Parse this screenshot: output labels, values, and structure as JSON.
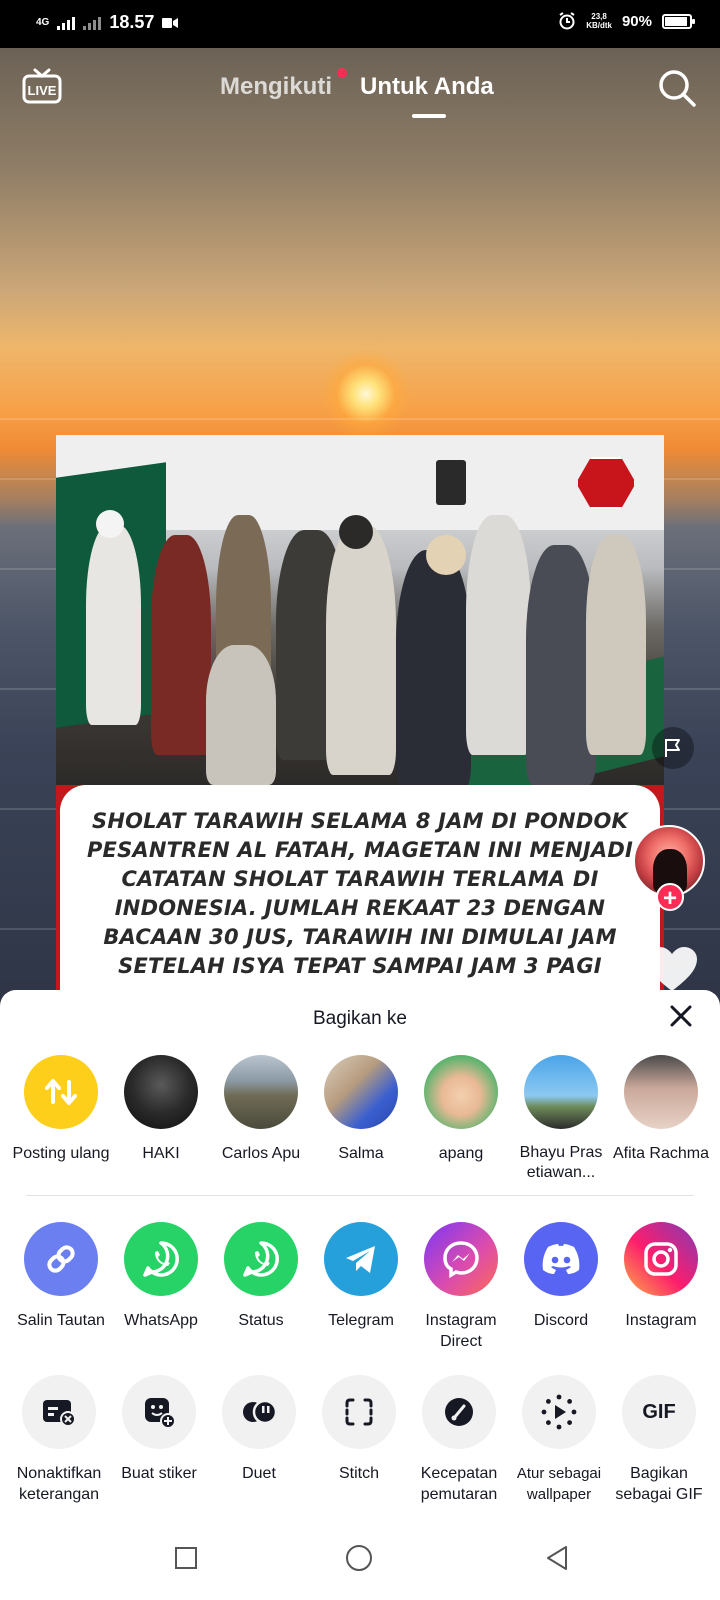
{
  "status_bar": {
    "network": "4G",
    "time": "18.57",
    "speed_value": "23,8",
    "speed_unit": "KB/dtk",
    "battery": "90%"
  },
  "top_nav": {
    "live_label": "LIVE",
    "tab_following": "Mengikuti",
    "tab_for_you": "Untuk Anda"
  },
  "video": {
    "caption": "SHOLAT TARAWIH SELAMA  8 JAM DI PONDOK PESANTREN AL FATAH, MAGETAN INI MENJADI CATATAN SHOLAT TARAWIH TERLAMA DI INDONESIA. JUMLAH REKAAT 23 DENGAN BACAAN 30 JUS, TARAWIH INI DIMULAI JAM SETELAH ISYA TEPAT SAMPAI JAM 3 PAGI",
    "follow_plus": "+"
  },
  "share_sheet": {
    "title": "Bagikan ke",
    "contacts": [
      {
        "label": "Posting ulang",
        "icon": "repost-icon"
      },
      {
        "label": "HAKI",
        "icon": "avatar"
      },
      {
        "label": "Carlos Apu",
        "icon": "avatar"
      },
      {
        "label": "Salma",
        "icon": "avatar"
      },
      {
        "label": "apang",
        "icon": "avatar"
      },
      {
        "label": "Bhayu Pras",
        "label2": "etiawan...",
        "icon": "avatar"
      },
      {
        "label": "Afita Rachma",
        "icon": "avatar"
      }
    ],
    "apps": [
      {
        "label": "Salin Tautan",
        "icon": "link-icon"
      },
      {
        "label": "WhatsApp",
        "icon": "whatsapp-icon"
      },
      {
        "label": "Status",
        "icon": "whatsapp-icon"
      },
      {
        "label": "Telegram",
        "icon": "telegram-icon"
      },
      {
        "label": "Instagram",
        "label2": "Direct",
        "icon": "messenger-icon"
      },
      {
        "label": "Discord",
        "icon": "discord-icon"
      },
      {
        "label": "Instagram",
        "icon": "instagram-icon"
      }
    ],
    "actions": [
      {
        "label": "Nonaktifkan",
        "label2": "keterangan",
        "icon": "caption-off-icon"
      },
      {
        "label": "Buat stiker",
        "icon": "sticker-icon"
      },
      {
        "label": "Duet",
        "icon": "duet-icon"
      },
      {
        "label": "Stitch",
        "icon": "stitch-icon"
      },
      {
        "label": "Kecepatan",
        "label2": "pemutaran",
        "icon": "speed-icon"
      },
      {
        "label": "Atur sebagai",
        "label2": "wallpaper",
        "icon": "wallpaper-icon"
      },
      {
        "label": "Bagikan",
        "label2": "sebagai GIF",
        "icon": "gif-icon",
        "icon_text": "GIF"
      }
    ]
  },
  "colors": {
    "accent": "#fe2c55",
    "repost": "#fdce1a",
    "whatsapp": "#27d366",
    "telegram": "#26a0da",
    "discord": "#5865f2",
    "link": "#6c7ff0"
  }
}
